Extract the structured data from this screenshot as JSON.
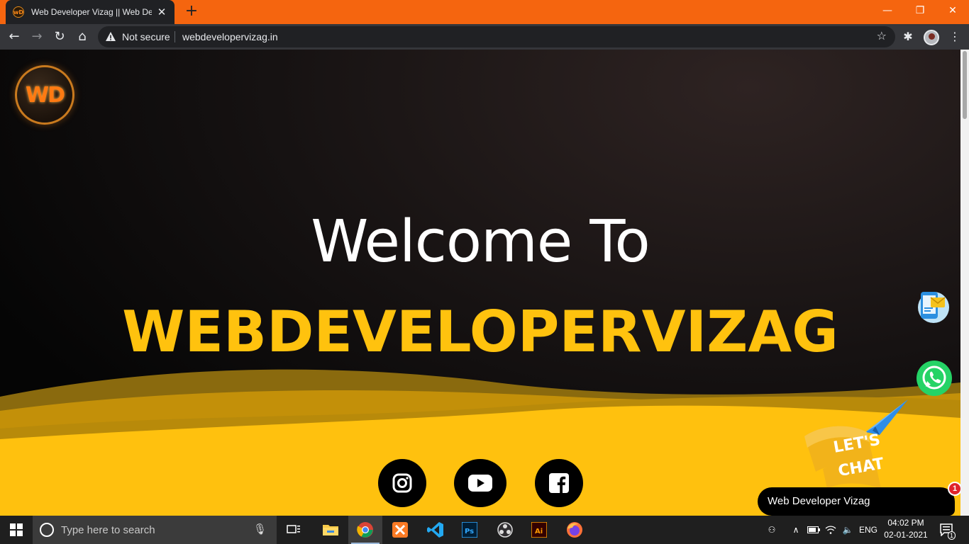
{
  "browser": {
    "tab_title": "Web Developer Vizag || Web Designing Company",
    "security_label": "Not secure",
    "url": "webdevelopervizag.in",
    "favicon_text": "wD"
  },
  "page": {
    "logo_text": "WD",
    "welcome": "Welcome To",
    "brand": "WEBDEVELOPERVIZAG",
    "social": [
      "instagram-icon",
      "youtube-icon",
      "facebook-icon"
    ],
    "chat_badge_text": "LET'S CHAT",
    "chat_label": "Web Developer Vizag",
    "chat_badge_count": "1",
    "colors": {
      "accent": "#ffc20e",
      "background": "#0a0808",
      "chrome": "#f5650f"
    }
  },
  "taskbar": {
    "search_placeholder": "Type here to search",
    "language": "ENG",
    "time": "04:02 PM",
    "date": "02-01-2021",
    "notification_count": "1",
    "apps": [
      "file-explorer-icon",
      "chrome-icon",
      "xampp-icon",
      "vscode-icon",
      "photoshop-icon",
      "obs-icon",
      "illustrator-icon",
      "firefox-icon"
    ]
  }
}
